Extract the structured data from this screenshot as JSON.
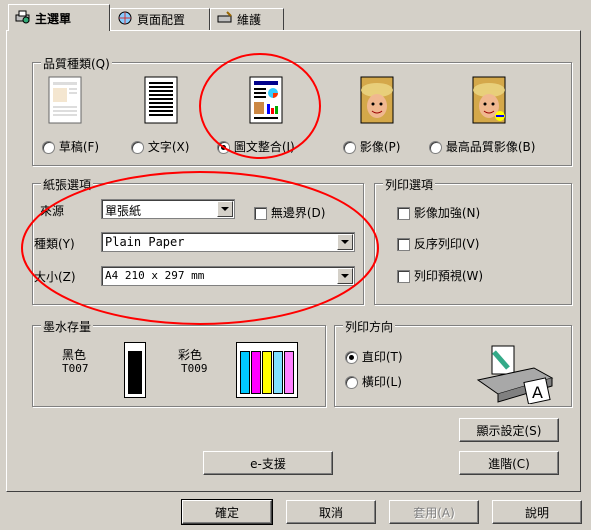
{
  "tabs": [
    {
      "label": "主選單",
      "icon": "printer-settings-icon"
    },
    {
      "label": "頁面配置",
      "icon": "page-layout-icon"
    },
    {
      "label": "維護",
      "icon": "maintenance-icon"
    }
  ],
  "quality": {
    "legend": "品質種類(Q)",
    "options": [
      {
        "label": "草稿(F)",
        "selected": false
      },
      {
        "label": "文字(X)",
        "selected": false
      },
      {
        "label": "圖文整合(I)",
        "selected": true
      },
      {
        "label": "影像(P)",
        "selected": false
      },
      {
        "label": "最高品質影像(B)",
        "selected": false
      }
    ]
  },
  "paper": {
    "legend": "紙張選項",
    "source_label": "來源",
    "source_value": "單張紙",
    "borderless_label": "無邊界(D)",
    "type_label": "種類(Y)",
    "type_value": "Plain Paper",
    "size_label": "大小(Z)",
    "size_value": "A4 210 x 297 mm"
  },
  "print_options": {
    "legend": "列印選項",
    "items": [
      "影像加強(N)",
      "反序列印(V)",
      "列印預視(W)"
    ]
  },
  "ink": {
    "legend": "墨水存量",
    "black_label": "黑色",
    "black_code": "T007",
    "color_label": "彩色",
    "color_code": "T009",
    "color_swatches": [
      "#00c8ff",
      "#ff00ff",
      "#ffff00",
      "#80e0ff",
      "#ff80ff"
    ]
  },
  "orientation": {
    "legend": "列印方向",
    "portrait": "直印(T)",
    "landscape": "橫印(L)"
  },
  "buttons": {
    "display_settings": "顯示設定(S)",
    "e_support": "e-支援",
    "advanced": "進階(C)",
    "ok": "確定",
    "cancel": "取消",
    "apply": "套用(A)",
    "help": "說明"
  },
  "annotation_color": "#ff0000"
}
